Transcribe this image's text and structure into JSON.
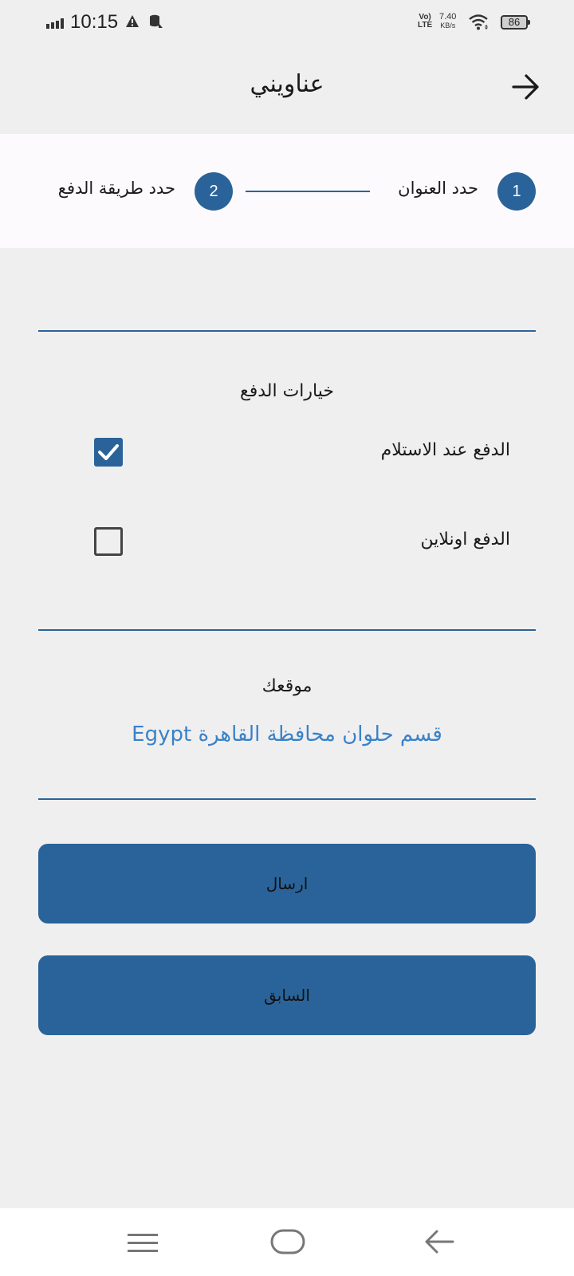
{
  "status_bar": {
    "time": "10:15",
    "volte_top": "Vo)",
    "volte_bottom": "LTE",
    "speed_value": "7.40",
    "speed_unit": "KB/s",
    "battery": "86"
  },
  "header": {
    "title": "عناويني"
  },
  "stepper": {
    "step1": {
      "number": "1",
      "label": "حدد العنوان"
    },
    "step2": {
      "number": "2",
      "label": "حدد طريقة الدفع"
    }
  },
  "payment": {
    "title": "خيارات الدفع",
    "options": [
      {
        "label": "الدفع عند الاستلام",
        "checked": true
      },
      {
        "label": "الدفع اونلاين",
        "checked": false
      }
    ]
  },
  "location": {
    "title": "موقعك",
    "value": "قسم حلوان محافظة القاهرة Egypt"
  },
  "buttons": {
    "submit": "ارسال",
    "previous": "السابق"
  },
  "colors": {
    "primary": "#2a6399",
    "link": "#3a82c8",
    "background": "#f0eff0"
  }
}
